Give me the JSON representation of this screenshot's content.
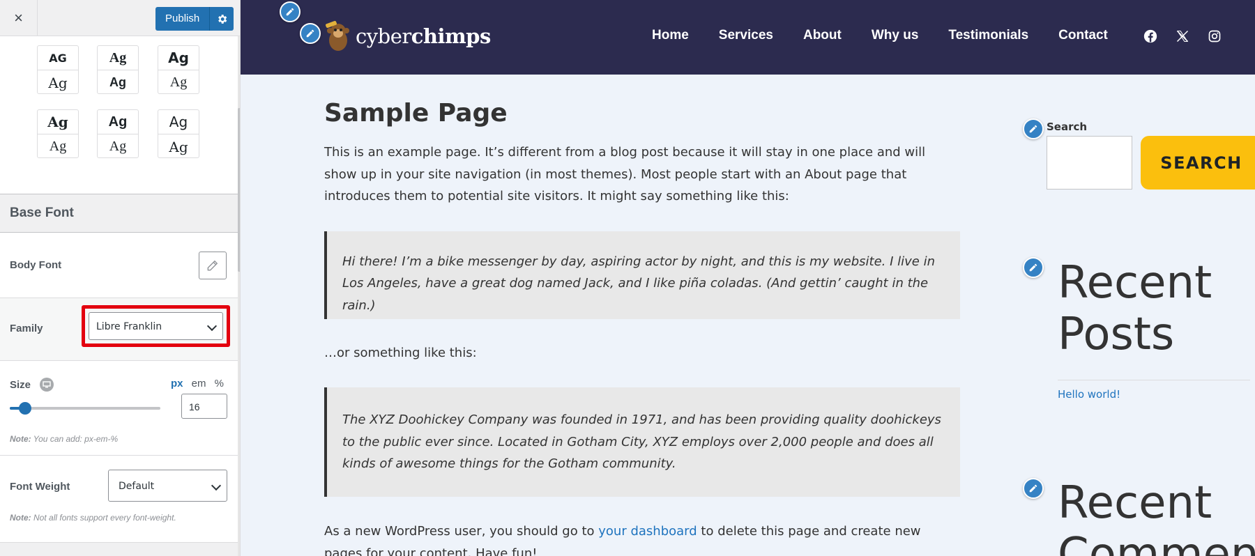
{
  "header": {
    "close_label": "×",
    "publish_label": "Publish"
  },
  "typography_presets": [
    {
      "top": "AG",
      "bottom": "Ag"
    },
    {
      "top": "Ag",
      "bottom": "Ag"
    },
    {
      "top": "Ag",
      "bottom": "Ag"
    },
    {
      "top": "Ag",
      "bottom": "Ag"
    },
    {
      "top": "Ag",
      "bottom": "Ag"
    },
    {
      "top": "Ag",
      "bottom": "Ag"
    }
  ],
  "base_font": {
    "section_title": "Base Font",
    "body_font_label": "Body Font",
    "family_label": "Family",
    "family_value": "Libre Franklin",
    "size_label": "Size",
    "units": [
      "px",
      "em",
      "%"
    ],
    "active_unit": "px",
    "size_value": "16",
    "size_fraction": 0.1,
    "size_note_prefix": "Note:",
    "size_note": " You can add: px-em-%",
    "weight_label": "Font Weight",
    "weight_value": "Default",
    "weight_note_prefix": "Note:",
    "weight_note": " Not all fonts support every font-weight."
  },
  "site": {
    "logo_regular": "cyber",
    "logo_bold": "chimps",
    "nav": [
      "Home",
      "Services",
      "About",
      "Why us",
      "Testimonials",
      "Contact"
    ],
    "social_icons": [
      "facebook-icon",
      "x-twitter-icon",
      "instagram-icon"
    ],
    "header_bg": "#2c2b4f",
    "accent": "#fbbf0d",
    "link_color": "#1e73be"
  },
  "page": {
    "title": "Sample Page",
    "intro": "This is an example page. It’s different from a blog post because it will stay in one place and will show up in your site navigation (in most themes). Most people start with an About page that introduces them to potential site visitors. It might say something like this:",
    "quote1": "Hi there! I’m a bike messenger by day, aspiring actor by night, and this is my website. I live in Los Angeles, have a great dog named Jack, and I like piña coladas. (And gettin’ caught in the rain.)",
    "or_text": "…or something like this:",
    "quote2": "The XYZ Doohickey Company was founded in 1971, and has been providing quality doohickeys to the public ever since. Located in Gotham City, XYZ employs over 2,000 people and does all kinds of awesome things for the Gotham community.",
    "outro_before": "As a new WordPress user, you should go to ",
    "outro_link": "your dashboard",
    "outro_after": " to delete this page and create new pages for your content. Have fun!"
  },
  "widgets": {
    "search_label": "Search",
    "search_button": "SEARCH",
    "recent_posts_line1": "Recent",
    "recent_posts_line2": "Posts",
    "recent_post_item": "Hello world!",
    "recent_comments_line1": "Recent",
    "recent_comments_line2": "Comment"
  }
}
